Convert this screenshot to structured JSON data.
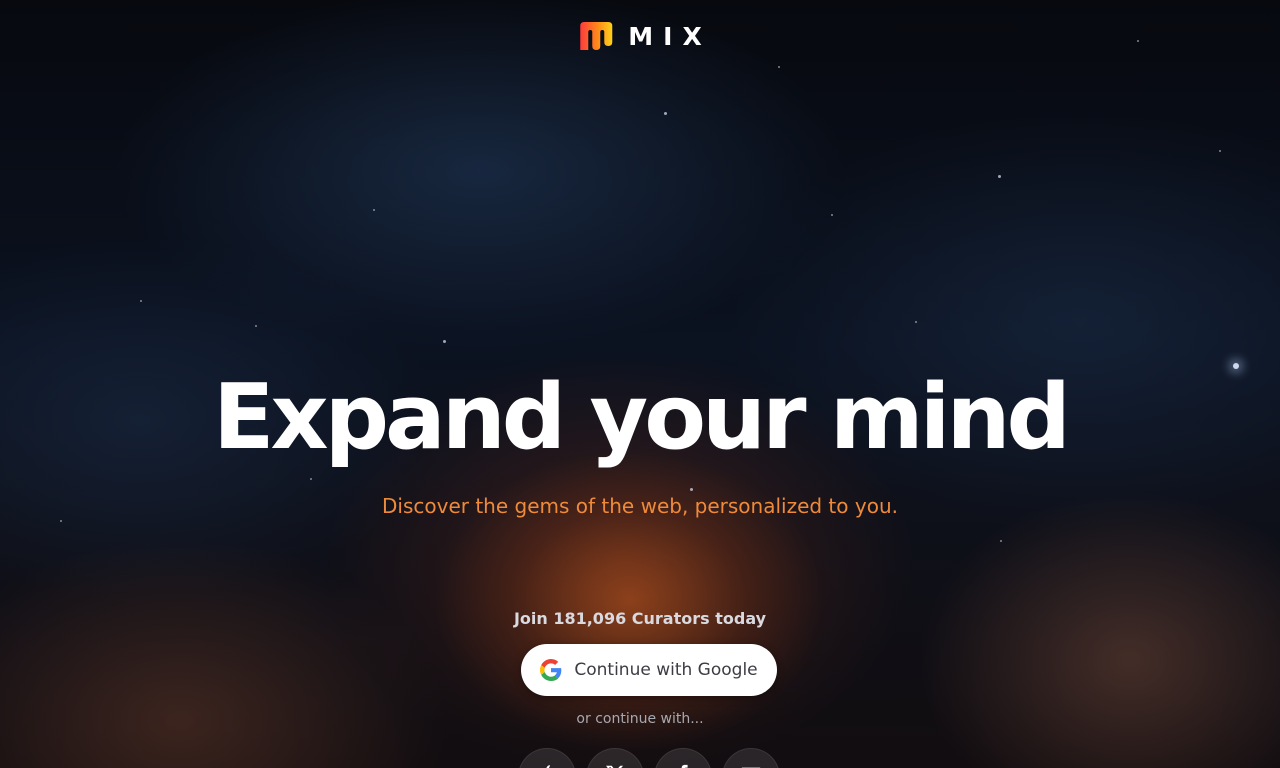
{
  "brand": {
    "name": "MIX",
    "logo_icon": "mix-logo-icon",
    "colors": {
      "logo_gradient_start": "#ff3b3b",
      "logo_gradient_mid": "#ff8a1a",
      "logo_gradient_end": "#ffd21a"
    }
  },
  "hero": {
    "headline": "Expand your mind",
    "tagline": "Discover the gems of the web, personalized to you."
  },
  "signup": {
    "join_text": "Join 181,096 Curators today",
    "google_button_label": "Continue with Google",
    "google_icon": "google-g-icon",
    "or_text": "or continue with...",
    "social_buttons": [
      {
        "name": "apple",
        "icon": "apple-icon"
      },
      {
        "name": "x",
        "icon": "x-icon"
      },
      {
        "name": "facebook",
        "icon": "facebook-icon"
      },
      {
        "name": "email",
        "icon": "email-icon"
      }
    ]
  },
  "colors": {
    "tagline": "#ee8a3a",
    "button_bg": "#ffffff",
    "background": "#05070c"
  }
}
